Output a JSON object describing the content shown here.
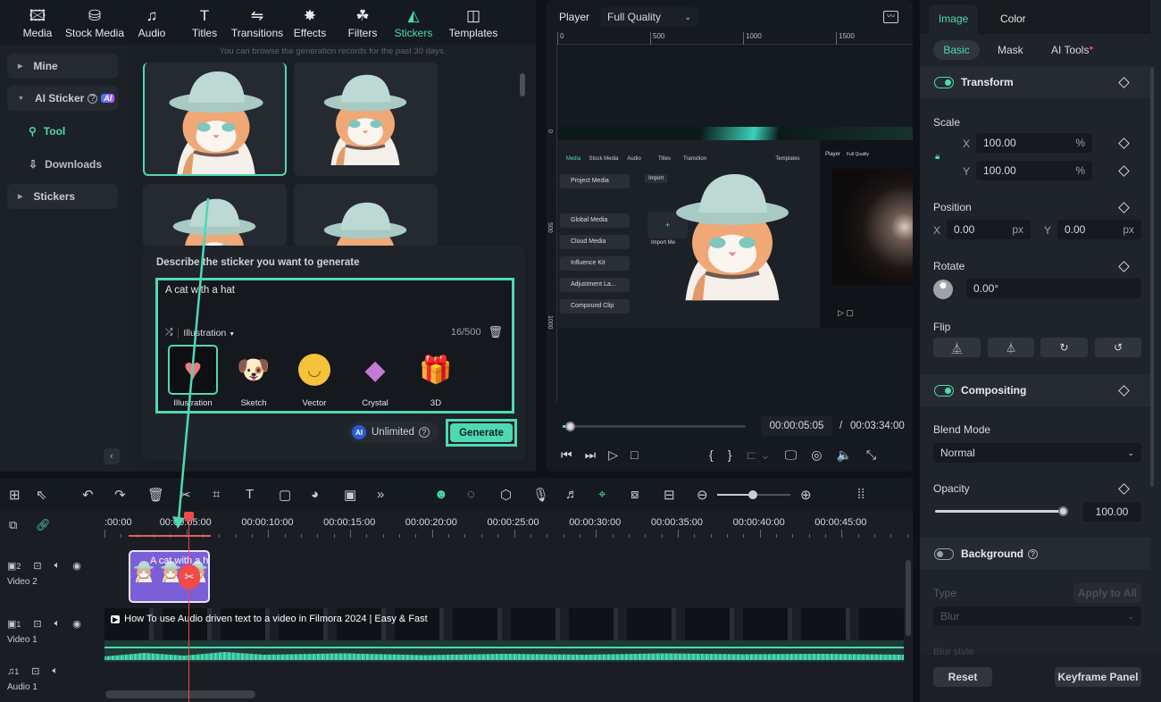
{
  "nav": {
    "items": [
      {
        "label": "Media",
        "icon": "media-icon"
      },
      {
        "label": "Stock Media",
        "icon": "stock-media-icon"
      },
      {
        "label": "Audio",
        "icon": "music-note-icon"
      },
      {
        "label": "Titles",
        "icon": "titles-icon"
      },
      {
        "label": "Transitions",
        "icon": "transitions-icon"
      },
      {
        "label": "Effects",
        "icon": "effects-icon"
      },
      {
        "label": "Filters",
        "icon": "filters-icon"
      },
      {
        "label": "Stickers",
        "icon": "stickers-icon",
        "active": true
      },
      {
        "label": "Templates",
        "icon": "templates-icon"
      }
    ]
  },
  "sidebar": {
    "mine": "Mine",
    "ai_sticker": "AI Sticker",
    "ai_badge": "AI",
    "tool": "Tool",
    "downloads": "Downloads",
    "stickers": "Stickers"
  },
  "content": {
    "hint": "You can browse the generation records for the past 30 days."
  },
  "prompt": {
    "title": "Describe the sticker you want to generate",
    "text": "A cat with a hat",
    "style": "Illustration",
    "count": "16/500",
    "styles": [
      {
        "label": "Illustration"
      },
      {
        "label": "Sketch"
      },
      {
        "label": "Vector"
      },
      {
        "label": "Crystal"
      },
      {
        "label": "3D"
      }
    ],
    "unlimited": "Unlimited",
    "generate": "Generate"
  },
  "player": {
    "label": "Player",
    "quality": "Full Quality",
    "ruler": [
      "0",
      "500",
      "1000",
      "1500"
    ],
    "vruler": [
      "0",
      "500",
      "1000"
    ],
    "current_time": "00:00:05:05",
    "separator": "/",
    "total_time": "00:03:34:00",
    "progress": 0.025,
    "mini": {
      "tabs": [
        "Media",
        "Stock Media",
        "Audio",
        "Titles",
        "Transition",
        "Templates"
      ],
      "items": [
        "Project Media",
        "Global Media",
        "Cloud Media",
        "Influence Kit",
        "Adjustment La...",
        "Compound Clip"
      ],
      "import": "Import",
      "import_media": "Import Me",
      "player": "Player",
      "quality": "Full Quality"
    }
  },
  "props": {
    "tabs": [
      "Image",
      "Color"
    ],
    "subtabs": [
      "Basic",
      "Mask",
      "AI Tools"
    ],
    "transform": "Transform",
    "scale": "Scale",
    "scale_x": "100.00",
    "scale_y": "100.00",
    "pct": "%",
    "x": "X",
    "y": "Y",
    "position": "Position",
    "pos_x": "0.00",
    "pos_y": "0.00",
    "px": "px",
    "rotate": "Rotate",
    "rotate_val": "0.00°",
    "flip": "Flip",
    "compositing": "Compositing",
    "blend_mode": "Blend Mode",
    "blend_value": "Normal",
    "opacity": "Opacity",
    "opacity_val": "100.00",
    "opacity_level": 100,
    "background": "Background",
    "type": "Type",
    "apply_all": "Apply to All",
    "bg_type": "Blur",
    "blur_style": "Blur style",
    "reset": "Reset",
    "keyframe": "Keyframe Panel"
  },
  "timeline": {
    "ticks": [
      ":00:00",
      "00:00:05:00",
      "00:00:10:00",
      "00:00:15:00",
      "00:00:20:00",
      "00:00:25:00",
      "00:00:30:00",
      "00:00:35:00",
      "00:00:40:00",
      "00:00:45:00"
    ],
    "tracks": [
      {
        "num": "2",
        "name": "Video 2"
      },
      {
        "num": "1",
        "name": "Video 1"
      },
      {
        "num": "1",
        "name": "Audio 1"
      }
    ],
    "sticker_clip": "A cat with a hat",
    "video_clip": "How To use Audio driven text to a video in Filmora 2024 | Easy & Fast"
  },
  "colors": {
    "accent": "#4fd8b4",
    "playhead": "#f04a4a",
    "clip_purple": "#7b5fd6"
  }
}
